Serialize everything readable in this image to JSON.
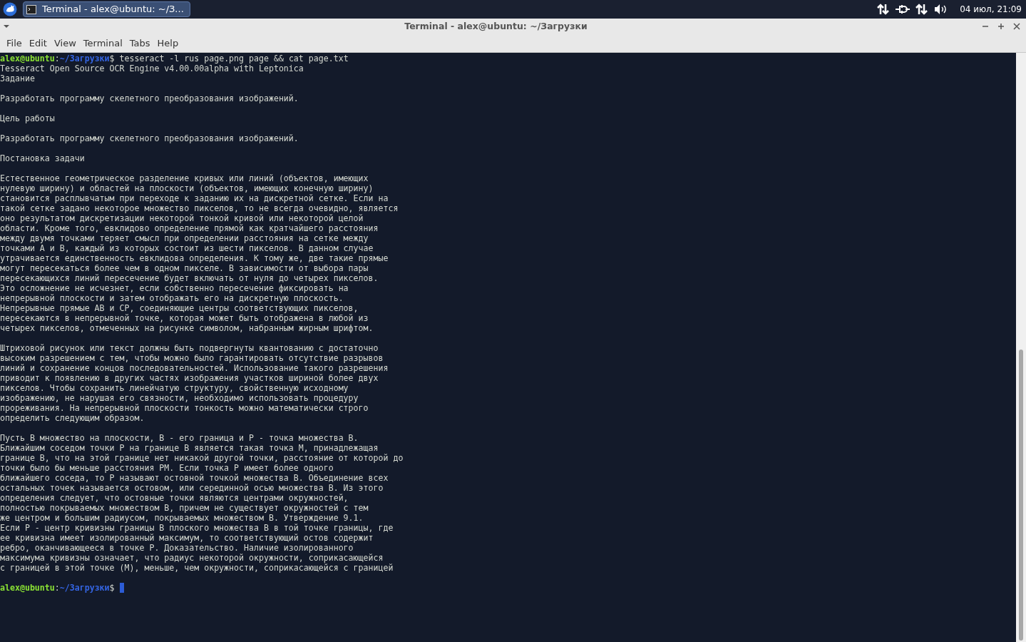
{
  "taskbar": {
    "task_button": {
      "label": "Terminal - alex@ubuntu: ~/З...",
      "selected": true
    },
    "clock": "04 июл, 21:09"
  },
  "window": {
    "title": "Terminal - alex@ubuntu: ~/Загрузки",
    "menu": [
      "File",
      "Edit",
      "View",
      "Terminal",
      "Tabs",
      "Help"
    ]
  },
  "terminal": {
    "lines": [
      {
        "kind": "prompt",
        "user": "alex@ubuntu",
        "sep": ":",
        "path": "~/Загрузки",
        "symbol": "$",
        "command": "tesseract -l rus page.png page && cat page.txt",
        "cursor": false
      },
      {
        "kind": "output",
        "text": "Tesseract Open Source OCR Engine v4.00.00alpha with Leptonica"
      },
      {
        "kind": "output",
        "text": "Задание"
      },
      {
        "kind": "blank"
      },
      {
        "kind": "output",
        "text": "Разработать программу скелетного преобразования изображений."
      },
      {
        "kind": "blank"
      },
      {
        "kind": "output",
        "text": "Цель работы"
      },
      {
        "kind": "blank"
      },
      {
        "kind": "output",
        "text": "Разработать программу скелетного преобразования изображений."
      },
      {
        "kind": "blank"
      },
      {
        "kind": "output",
        "text": "Постановка задачи"
      },
      {
        "kind": "blank"
      },
      {
        "kind": "output",
        "text": "Естественное геометрическое разделение кривых или линий (объектов, имеющих"
      },
      {
        "kind": "output",
        "text": "нулевую ширину) и областей на плоскости (объектов, имеющих конечную ширину)"
      },
      {
        "kind": "output",
        "text": "становится расплывчатым при переходе к заданию их на дискретной сетке. Если на"
      },
      {
        "kind": "output",
        "text": "такой сетке задано некоторое множество пикселов, то не всегда очевидно, является"
      },
      {
        "kind": "output",
        "text": "оно результатом дискретизации некоторой тонкой кривой или некоторой целой"
      },
      {
        "kind": "output",
        "text": "области. Кроме того, евклидово определение прямой как кратчайшего расстояния"
      },
      {
        "kind": "output",
        "text": "между двумя точками теряет смысл при определении расстояния на сетке между"
      },
      {
        "kind": "output",
        "text": "точками А и В, каждый из которых состоит из шести пикселов. В данном случае"
      },
      {
        "kind": "output",
        "text": "утрачивается единственность евклидова определения. К тому же, две такие прямые"
      },
      {
        "kind": "output",
        "text": "могут пересекаться более чем в одном пикселе. В зависимости от выбора пары"
      },
      {
        "kind": "output",
        "text": "пересекающихся линий пересечение будет включать от нуля до четырех пикселов."
      },
      {
        "kind": "output",
        "text": "Это осложнение не исчезнет, если собственно пересечение фиксировать на"
      },
      {
        "kind": "output",
        "text": "непрерывной плоскости и затем отображать его на дискретную плоскость."
      },
      {
        "kind": "output",
        "text": "Непрерывные прямые АВ и СР, соединяющие центры соответствующих пикселов,"
      },
      {
        "kind": "output",
        "text": "пересекаются в непрерывной точке, которая может быть отображена в любой из"
      },
      {
        "kind": "output",
        "text": "четырех пикселов, отмеченных на рисунке символом, набранным жирным шрифтом."
      },
      {
        "kind": "blank"
      },
      {
        "kind": "output",
        "text": "Штриховой рисунок или текст должны быть подвергнуты квантованию с достаточно"
      },
      {
        "kind": "output",
        "text": "высоким разрешением с тем, чтобы можно было гарантировать отсутствие разрывов"
      },
      {
        "kind": "output",
        "text": "линий и сохранение концов последовательностей. Использование такого разрешения"
      },
      {
        "kind": "output",
        "text": "приводит к появлению в других частях изображения участков шириной более двух"
      },
      {
        "kind": "output",
        "text": "пикселов. Чтобы сохранить линейчатую структуру, свойственную исходному"
      },
      {
        "kind": "output",
        "text": "изображению, не нарушая его связности, необходимо использовать процедуру"
      },
      {
        "kind": "output",
        "text": "прореживания. На непрерывной плоскости тонкость можно математически строго"
      },
      {
        "kind": "output",
        "text": "определить следующим образом."
      },
      {
        "kind": "blank"
      },
      {
        "kind": "output",
        "text": "Пусть В множество на плоскости, В - его граница и Р - точка множества В."
      },
      {
        "kind": "output",
        "text": "Ближайшим соседом точки Р на границе В является такая точка М, принадлежащая"
      },
      {
        "kind": "output",
        "text": "границе В, что на этой границе нет никакой другой точки, расстояние от которой до"
      },
      {
        "kind": "output",
        "text": "точки было бы меньше расстояния РМ. Если точка Р имеет более одного"
      },
      {
        "kind": "output",
        "text": "ближайшего соседа, то Р называют остовной точкой множества В. Объединение всех"
      },
      {
        "kind": "output",
        "text": "остальных точек называется остовом, или серединной осью множества В. Из этого"
      },
      {
        "kind": "output",
        "text": "определения следует, что остовные точки являются центрами окружностей,"
      },
      {
        "kind": "output",
        "text": "полностью покрываемых множеством В, причем не существует окружностей с тем"
      },
      {
        "kind": "output",
        "text": "же центром и большим радиусом, покрываемых множеством В. Утверждение 9.1."
      },
      {
        "kind": "output",
        "text": "Если Р - центр кривизны границы В плоского множества В в той точке границы, где"
      },
      {
        "kind": "output",
        "text": "ее кривизна имеет изолированный максимум, то соответствующий остов содержит"
      },
      {
        "kind": "output",
        "text": "ребро, оканчивающееся в точке Р. Доказательство. Наличие изолированного"
      },
      {
        "kind": "output",
        "text": "максимума кривизны означает, что радиус некоторой окружности, соприкасающейся"
      },
      {
        "kind": "output",
        "text": "с границей в этой точке (М), меньше, чем окружности, соприкасающейся с границей"
      },
      {
        "kind": "blank"
      },
      {
        "kind": "prompt",
        "user": "alex@ubuntu",
        "sep": ":",
        "path": "~/Загрузки",
        "symbol": "$",
        "cursor": true
      }
    ]
  }
}
